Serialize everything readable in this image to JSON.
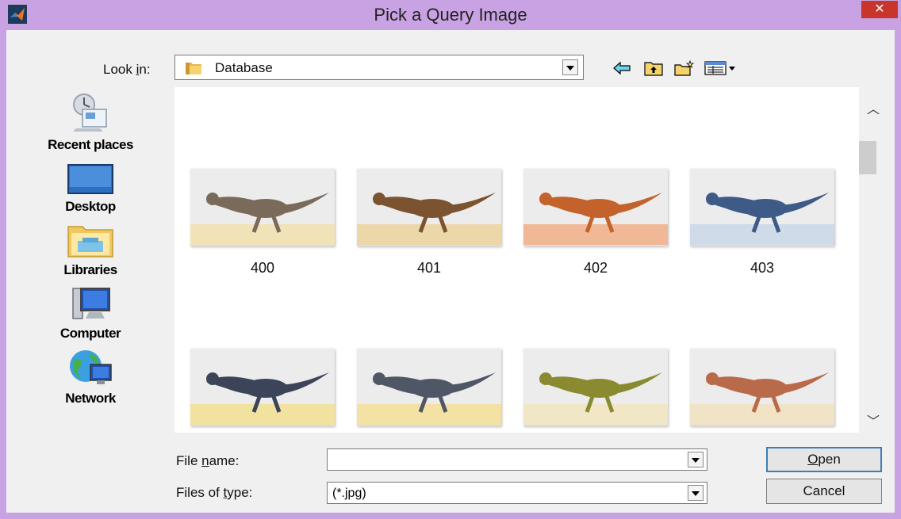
{
  "window": {
    "title": "Pick a Query Image",
    "close_glyph": "✕",
    "app_icon": "matlab-logo-icon"
  },
  "look_in": {
    "label_before": "Look ",
    "label_mnemonic": "i",
    "label_after": "n:",
    "value": "Database",
    "folder_icon": "folder-icon"
  },
  "toolbar": {
    "icons": [
      "back-icon",
      "up-folder-icon",
      "new-folder-icon",
      "view-menu-icon"
    ]
  },
  "places": [
    {
      "label": "Recent places",
      "icon": "recent-places-icon"
    },
    {
      "label": "Desktop",
      "icon": "desktop-icon"
    },
    {
      "label": "Libraries",
      "icon": "libraries-icon"
    },
    {
      "label": "Computer",
      "icon": "computer-icon"
    },
    {
      "label": "Network",
      "icon": "network-icon"
    }
  ],
  "files": [
    {
      "name": "400",
      "ground": "#f1e2b8",
      "body": "#7a6a5a"
    },
    {
      "name": "401",
      "ground": "#ecd7a8",
      "body": "#7b5330"
    },
    {
      "name": "402",
      "ground": "#f0b896",
      "body": "#c4622c"
    },
    {
      "name": "403",
      "ground": "#cfdbe8",
      "body": "#3e5a86"
    },
    {
      "name": "",
      "ground": "#f2e2a0",
      "body": "#3b4458"
    },
    {
      "name": "",
      "ground": "#f3e2a4",
      "body": "#4f5766"
    },
    {
      "name": "",
      "ground": "#f1e7c6",
      "body": "#8a8a30"
    },
    {
      "name": "",
      "ground": "#f1e3c6",
      "body": "#b86a4a"
    }
  ],
  "file_name": {
    "label_before": "File ",
    "label_mnemonic": "n",
    "label_after": "ame:",
    "value": ""
  },
  "file_type": {
    "label_before": "Files of ",
    "label_mnemonic": "t",
    "label_after": "ype:",
    "value": "(*.jpg)"
  },
  "buttons": {
    "open_mnemonic": "O",
    "open_rest": "pen",
    "cancel": "Cancel"
  }
}
